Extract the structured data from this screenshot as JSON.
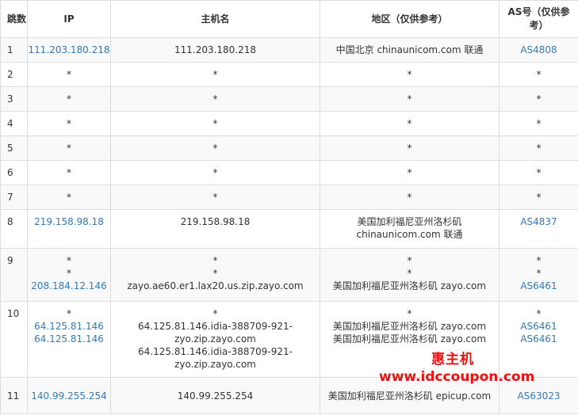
{
  "headers": {
    "hop": "跳数",
    "ip": "IP",
    "host": "主机名",
    "region": "地区（仅供参考）",
    "as": "AS号（仅供参考）"
  },
  "rows": [
    {
      "hop": "1",
      "ip": [
        "111.203.180.218"
      ],
      "host": [
        "111.203.180.218"
      ],
      "region": [
        "中国北京 chinaunicom.com 联通"
      ],
      "as": [
        "AS4808"
      ]
    },
    {
      "hop": "2",
      "ip": [
        "*"
      ],
      "host": [
        "*"
      ],
      "region": [
        "*"
      ],
      "as": [
        "*"
      ]
    },
    {
      "hop": "3",
      "ip": [
        "*"
      ],
      "host": [
        "*"
      ],
      "region": [
        "*"
      ],
      "as": [
        "*"
      ]
    },
    {
      "hop": "4",
      "ip": [
        "*"
      ],
      "host": [
        "*"
      ],
      "region": [
        "*"
      ],
      "as": [
        "*"
      ]
    },
    {
      "hop": "5",
      "ip": [
        "*"
      ],
      "host": [
        "*"
      ],
      "region": [
        "*"
      ],
      "as": [
        "*"
      ]
    },
    {
      "hop": "6",
      "ip": [
        "*"
      ],
      "host": [
        "*"
      ],
      "region": [
        "*"
      ],
      "as": [
        "*"
      ]
    },
    {
      "hop": "7",
      "ip": [
        "*"
      ],
      "host": [
        "*"
      ],
      "region": [
        "*"
      ],
      "as": [
        "*"
      ]
    },
    {
      "hop": "8",
      "ip": [
        "219.158.98.18"
      ],
      "host": [
        "219.158.98.18"
      ],
      "region": [
        "美国加利福尼亚州洛杉矶",
        "chinaunicom.com 联通"
      ],
      "as": [
        "AS4837"
      ]
    },
    {
      "hop": "9",
      "ip": [
        "*",
        "*",
        "208.184.12.146"
      ],
      "host": [
        "*",
        "*",
        "zayo.ae60.er1.lax20.us.zip.zayo.com"
      ],
      "region": [
        "*",
        "*",
        "美国加利福尼亚州洛杉矶 zayo.com"
      ],
      "as": [
        "*",
        "*",
        "AS6461"
      ]
    },
    {
      "hop": "10",
      "ip": [
        "*",
        "64.125.81.146",
        "64.125.81.146"
      ],
      "host": [
        "*",
        "64.125.81.146.idia-388709-921-",
        "zyo.zip.zayo.com",
        "64.125.81.146.idia-388709-921-",
        "zyo.zip.zayo.com"
      ],
      "region": [
        "*",
        "美国加利福尼亚州洛杉矶 zayo.com",
        "美国加利福尼亚州洛杉矶 zayo.com"
      ],
      "as": [
        "*",
        "AS6461",
        "AS6461"
      ]
    },
    {
      "hop": "11",
      "ip": [
        "140.99.255.254"
      ],
      "host": [
        "140.99.255.254"
      ],
      "region": [
        "美国加利福尼亚州洛杉矶 epicup.com"
      ],
      "as": [
        "AS63023"
      ]
    }
  ],
  "watermark": {
    "line1": "惠主机",
    "line2": "www.idccoupon.com"
  },
  "colors": {
    "link": "#337ab7",
    "border": "#dddddd",
    "stripe": "#f9f9f9",
    "watermark": "#ee1111"
  }
}
